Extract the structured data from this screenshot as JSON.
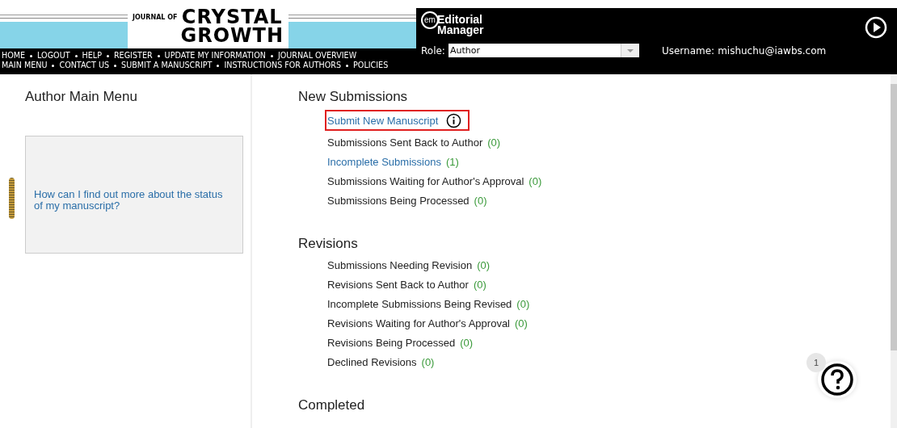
{
  "journal_logo": {
    "prefix": "JOURNAL OF",
    "line_1": "CRYSTAL",
    "line_2": "GROWTH"
  },
  "nav_rows": [
    [
      "HOME",
      "LOGOUT",
      "HELP",
      "REGISTER",
      "UPDATE MY INFORMATION",
      "JOURNAL OVERVIEW"
    ],
    [
      "MAIN MENU",
      "CONTACT US",
      "SUBMIT A MANUSCRIPT",
      "INSTRUCTIONS FOR AUTHORS",
      "POLICIES"
    ]
  ],
  "em_logo": {
    "badge": "em",
    "line_1": "Editorial",
    "line_2": "Manager"
  },
  "role": {
    "label": "Role:",
    "value": "Author"
  },
  "username": {
    "label": "Username:",
    "value": "mishuchu@iawbs.com"
  },
  "sidebar": {
    "title": "Author Main Menu",
    "help_question": "How can I find out more about the status of my manuscript?"
  },
  "sections": [
    {
      "title": "New Submissions",
      "items": [
        {
          "label": "Submit New Manuscript",
          "link": true,
          "highlighted": true,
          "info": true
        },
        {
          "label": "Submissions Sent Back to Author",
          "count": "(0)",
          "link": false,
          "highlighted": false,
          "info": false
        },
        {
          "label": "Incomplete Submissions",
          "count": "(1)",
          "link": true,
          "highlighted": false,
          "info": false
        },
        {
          "label": "Submissions Waiting for Author's Approval",
          "count": "(0)",
          "link": false,
          "highlighted": false,
          "info": false
        },
        {
          "label": "Submissions Being Processed",
          "count": "(0)",
          "link": false,
          "highlighted": false,
          "info": false
        }
      ]
    },
    {
      "title": "Revisions",
      "items": [
        {
          "label": "Submissions Needing Revision",
          "count": "(0)",
          "link": false,
          "highlighted": false,
          "info": false
        },
        {
          "label": "Revisions Sent Back to Author",
          "count": "(0)",
          "link": false,
          "highlighted": false,
          "info": false
        },
        {
          "label": "Incomplete Submissions Being Revised",
          "count": "(0)",
          "link": false,
          "highlighted": false,
          "info": false
        },
        {
          "label": "Revisions Waiting for Author's Approval",
          "count": "(0)",
          "link": false,
          "highlighted": false,
          "info": false
        },
        {
          "label": "Revisions Being Processed",
          "count": "(0)",
          "link": false,
          "highlighted": false,
          "info": false
        },
        {
          "label": "Declined Revisions",
          "count": "(0)",
          "link": false,
          "highlighted": false,
          "info": false
        }
      ]
    },
    {
      "title": "Completed"
    }
  ],
  "help_button": {
    "badge": "1"
  }
}
